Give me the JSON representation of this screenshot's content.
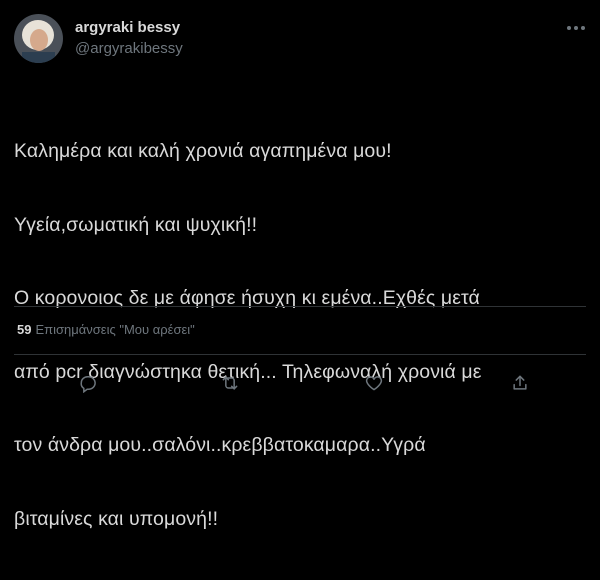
{
  "tweet": {
    "display_name": "argyraki bessy",
    "handle": "@argyrakibessy",
    "lines": [
      "Καλημέρα και καλή χρονιά αγαπημένα μου!",
      "Υγεία,σωματική και ψυχική!!",
      "Ο κορονοιος δε με άφησε ήσυχη κι εμένα..Εχθές μετά",
      "από pcr διαγνώστηκα θετική... Τηλεφωναλή χρονιά με",
      "τον άνδρα μου..σαλόνι..κρεββατοκαμαρα..Υγρά",
      "βιταμίνες και υπομονή!!"
    ]
  },
  "stats": {
    "likes_count": "59",
    "likes_label": "Επισημάνσεις \"Μου αρέσει\""
  },
  "icons": {
    "more": "more-icon",
    "reply": "reply-icon",
    "retweet": "retweet-icon",
    "like": "like-icon",
    "share": "share-icon"
  },
  "colors": {
    "background": "#000000",
    "text": "#d9d9d9",
    "secondary_text": "#6e767d",
    "divider": "#2f3336"
  }
}
